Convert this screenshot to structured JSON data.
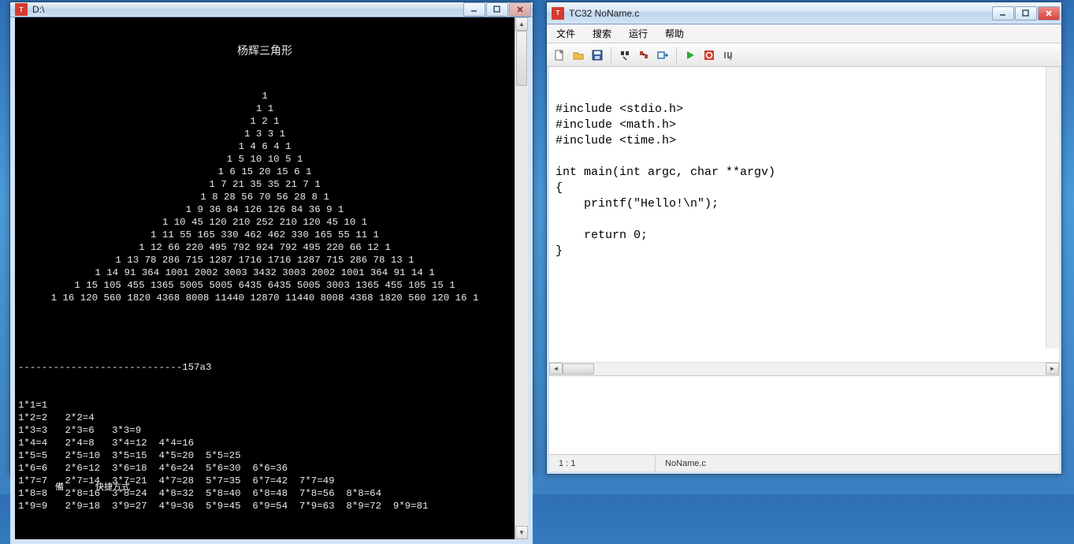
{
  "console": {
    "title": "D:\\",
    "triangle_title": "杨辉三角形",
    "triangle_rows": [
      "1",
      "1 1",
      "1 2 1",
      "1 3 3 1",
      "1 4 6 4 1",
      "1 5 10 10 5 1",
      "1 6 15 20 15 6 1",
      "1 7 21 35 35 21 7 1",
      "1 8 28 56 70 56 28 8 1",
      "1 9 36 84 126 126 84 36 9 1",
      "1 10 45 120 210 252 210 120 45 10 1",
      "1 11 55 165 330 462 462 330 165 55 11 1",
      "1 12 66 220 495 792 924 792 495 220 66 12 1",
      "1 13 78 286 715 1287 1716 1716 1287 715 286 78 13 1",
      "1 14 91 364 1001 2002 3003 3432 3003 2002 1001 364 91 14 1",
      "1 15 105 455 1365 5005 5005 6435 6435 5005 3003 1365 455 105 15 1",
      "1 16 120 560 1820 4368 8008 11440 12870 11440 8008 4368 1820 560 120 16 1"
    ],
    "divider": "----------------------------157a3",
    "mult_table": [
      "1*1=1",
      "1*2=2   2*2=4",
      "1*3=3   2*3=6   3*3=9",
      "1*4=4   2*4=8   3*4=12  4*4=16",
      "1*5=5   2*5=10  3*5=15  4*5=20  5*5=25",
      "1*6=6   2*6=12  3*6=18  4*6=24  5*6=30  6*6=36",
      "1*7=7   2*7=14  3*7=21  4*7=28  5*7=35  6*7=42  7*7=49",
      "1*8=8   2*8=16  3*8=24  4*8=32  5*8=40  6*8=48  7*8=56  8*8=64",
      "1*9=9   2*9=18  3*9=27  4*9=36  5*9=45  6*9=54  7*9=63  8*9=72  9*9=81"
    ]
  },
  "editor": {
    "title": "TC32 NoName.c",
    "menus": {
      "file": "文件",
      "search": "搜索",
      "run": "运行",
      "help": "帮助"
    },
    "code_lines": [
      "#include <stdio.h>",
      "#include <math.h>",
      "#include <time.h>",
      "",
      "int main(int argc, char **argv)",
      "{",
      "    printf(\"Hello!\\n\");",
      "",
      "    return 0;",
      "}"
    ],
    "status": {
      "pos": "1 : 1",
      "file": "NoName.c"
    }
  },
  "taskbar": {
    "hint1": "備",
    "hint2": "快捷方式"
  }
}
